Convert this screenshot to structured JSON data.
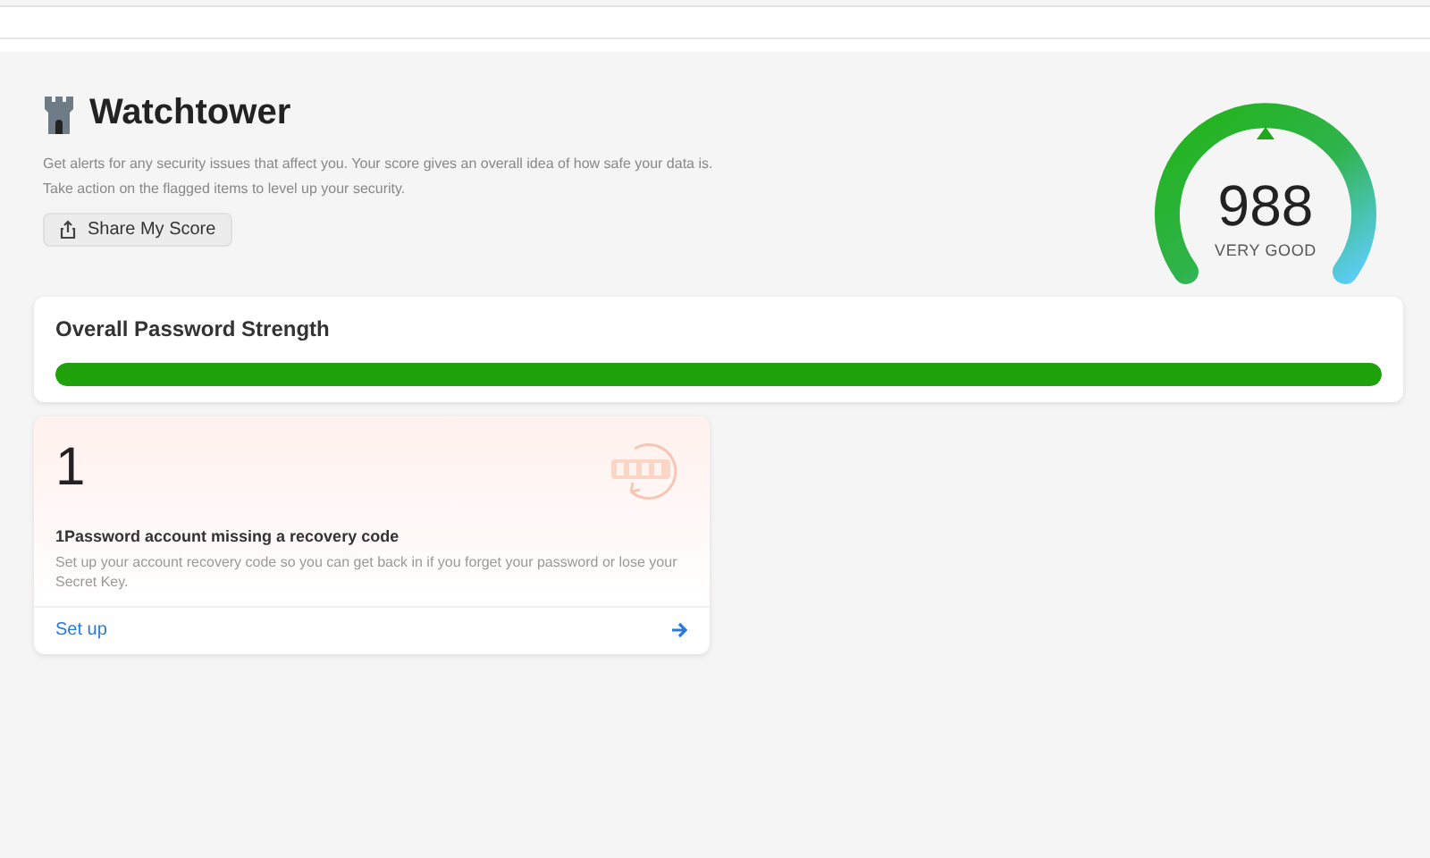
{
  "header": {
    "title": "Watchtower",
    "description": "Get alerts for any security issues that affect you. Your score gives an overall idea of how safe your data is. Take action on the flagged items to level up your security.",
    "share_button": "Share My Score"
  },
  "score": {
    "value": "988",
    "rating": "VERY GOOD"
  },
  "strength": {
    "title": "Overall Password Strength",
    "level": 1
  },
  "alerts": [
    {
      "count": "1",
      "title": "1Password account missing a recovery code",
      "description": "Set up your account recovery code so you can get back in if you forget your password or lose your Secret Key.",
      "action": "Set up"
    }
  ]
}
